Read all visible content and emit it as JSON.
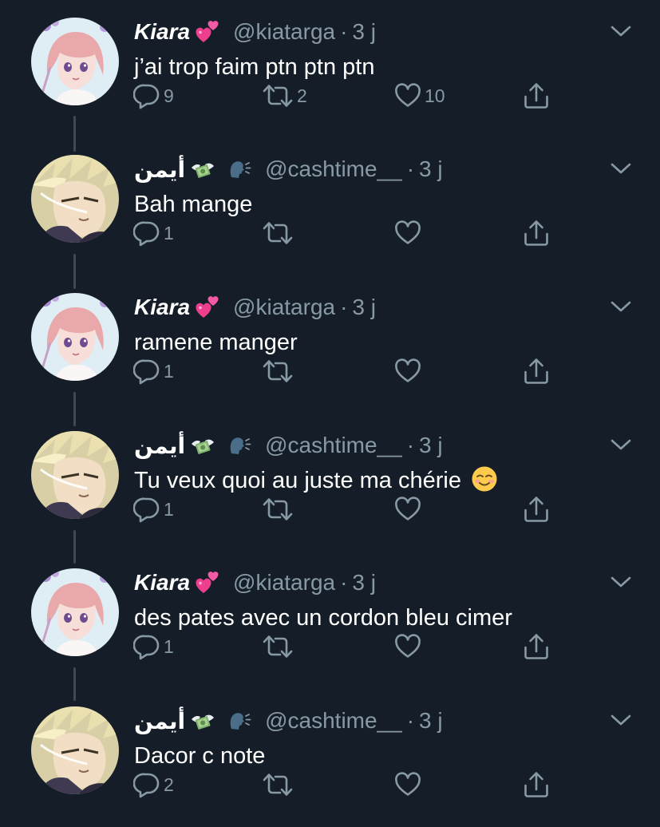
{
  "accent_colors": {
    "background": "#151e28",
    "text_primary": "#ffffff",
    "text_secondary": "#8899a6",
    "thread_line": "#3d4957"
  },
  "icons": {
    "reply": "reply-bubble-icon",
    "retweet": "retweet-icon",
    "like": "heart-icon",
    "share": "share-upload-icon",
    "more": "chevron-down-icon"
  },
  "tweets": [
    {
      "display_name": "Kiara",
      "name_emoji": "two-hearts-emoji",
      "handle": "@kiatarga",
      "separator": "·",
      "time": "3 j",
      "text": "j’ai trop faim ptn ptn ptn",
      "replies": "9",
      "retweets": "2",
      "likes": "10"
    },
    {
      "display_name": "أيمن",
      "name_emoji": "money-with-wings-emoji",
      "name_emoji_2": "speaking-head-emoji",
      "handle": "@cashtime__",
      "separator": "·",
      "time": "3 j",
      "text": "Bah mange",
      "replies": "1",
      "retweets": "",
      "likes": ""
    },
    {
      "display_name": "Kiara",
      "name_emoji": "two-hearts-emoji",
      "handle": "@kiatarga",
      "separator": "·",
      "time": "3 j",
      "text": "ramene manger",
      "replies": "1",
      "retweets": "",
      "likes": ""
    },
    {
      "display_name": "أيمن",
      "name_emoji": "money-with-wings-emoji",
      "name_emoji_2": "speaking-head-emoji",
      "handle": "@cashtime__",
      "separator": "·",
      "time": "3 j",
      "text": "Tu veux quoi au juste ma chérie",
      "text_emoji": "smiling-face-emoji",
      "replies": "1",
      "retweets": "",
      "likes": ""
    },
    {
      "display_name": "Kiara",
      "name_emoji": "two-hearts-emoji",
      "handle": "@kiatarga",
      "separator": "·",
      "time": "3 j",
      "text": "des pates avec un cordon bleu cimer",
      "replies": "1",
      "retweets": "",
      "likes": ""
    },
    {
      "display_name": "أيمن",
      "name_emoji": "money-with-wings-emoji",
      "name_emoji_2": "speaking-head-emoji",
      "handle": "@cashtime__",
      "separator": "·",
      "time": "3 j",
      "text": "Dacor c note",
      "replies": "2",
      "retweets": "",
      "likes": ""
    }
  ]
}
